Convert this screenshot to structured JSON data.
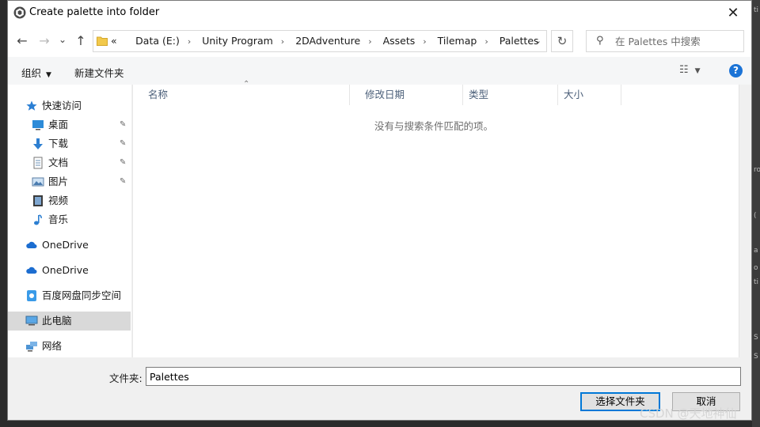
{
  "background": {
    "side_fragments": [
      "ti",
      "ro",
      "(",
      "a",
      "o",
      "ti",
      "S",
      "S"
    ]
  },
  "dialog": {
    "title": "Create palette into folder",
    "close_glyph": "✕"
  },
  "navigation": {
    "back_glyph": "←",
    "forward_glyph": "→",
    "recent_glyph": "⌄",
    "up_glyph": "↑",
    "breadcrumb_prefix": "«",
    "breadcrumbs": [
      "Data (E:)",
      "Unity Program",
      "2DAdventure",
      "Assets",
      "Tilemap",
      "Palettes"
    ],
    "refresh_glyph": "↻",
    "search_placeholder": "在 Palettes 中搜索"
  },
  "toolbar": {
    "organize_label": "组织",
    "new_folder_label": "新建文件夹",
    "view_glyph": "☷",
    "help_glyph": "?"
  },
  "sidebar": {
    "items": [
      {
        "label": "快速访问",
        "icon": "star-icon"
      },
      {
        "label": "桌面",
        "icon": "desktop-icon",
        "pinned": true
      },
      {
        "label": "下载",
        "icon": "download-icon",
        "pinned": true
      },
      {
        "label": "文档",
        "icon": "document-icon",
        "pinned": true
      },
      {
        "label": "图片",
        "icon": "picture-icon",
        "pinned": true
      },
      {
        "label": "视频",
        "icon": "video-icon"
      },
      {
        "label": "音乐",
        "icon": "music-icon"
      },
      {
        "label": "OneDrive",
        "icon": "cloud-icon"
      },
      {
        "label": "OneDrive",
        "icon": "cloud-icon"
      },
      {
        "label": "百度网盘同步空间",
        "icon": "baidu-netdisk-icon"
      },
      {
        "label": "此电脑",
        "icon": "computer-icon",
        "selected": true
      },
      {
        "label": "网络",
        "icon": "network-icon"
      }
    ],
    "pin_glyph": "📌"
  },
  "file_list": {
    "columns": [
      "名称",
      "修改日期",
      "类型",
      "大小"
    ],
    "empty_message": "没有与搜索条件匹配的项。"
  },
  "footer": {
    "folder_label": "文件夹:",
    "folder_value": "Palettes",
    "select_button": "选择文件夹",
    "cancel_button": "取消"
  },
  "watermark": "CSDN @天地神仙",
  "colors": {
    "accent": "#0078d7",
    "help": "#1b73d6",
    "selected_row": "#d9d9d9"
  }
}
